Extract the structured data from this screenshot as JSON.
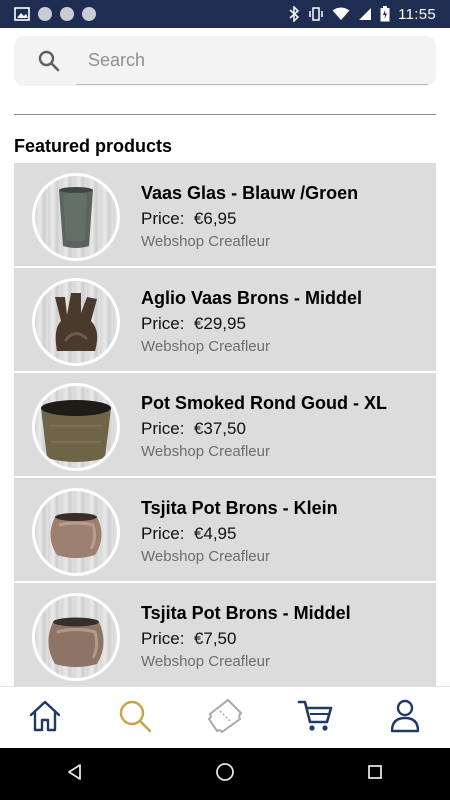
{
  "status_bar": {
    "time": "11:55"
  },
  "search": {
    "placeholder": "Search",
    "value": ""
  },
  "featured": {
    "title": "Featured products",
    "products": [
      {
        "title": "Vaas Glas - Blauw /Groen",
        "price_label": "Price:",
        "price": "€6,95",
        "shop": "Webshop Creafleur",
        "image": "green-glass-vase"
      },
      {
        "title": "Aglio Vaas Brons - Middel",
        "price_label": "Price:",
        "price": "€29,95",
        "shop": "Webshop Creafleur",
        "image": "bronze-garlic-vase"
      },
      {
        "title": "Pot Smoked Rond Goud - XL",
        "price_label": "Price:",
        "price": "€37,50",
        "shop": "Webshop Creafleur",
        "image": "gold-smoked-pot"
      },
      {
        "title": "Tsjita Pot Brons - Klein",
        "price_label": "Price:",
        "price": "€4,95",
        "shop": "Webshop Creafleur",
        "image": "bronze-round-pot"
      },
      {
        "title": "Tsjita Pot Brons - Middel",
        "price_label": "Price:",
        "price": "€7,50",
        "shop": "Webshop Creafleur",
        "image": "bronze-round-pot"
      }
    ]
  },
  "bottom_nav": {
    "items": [
      "home-icon",
      "search-icon",
      "ticket-icon",
      "cart-icon",
      "user-icon"
    ],
    "active": "search-icon"
  },
  "colors": {
    "status_bar": "#1f2d52",
    "nav_icon": "#1f3a66",
    "nav_active": "#c9a24a",
    "card_bg": "#dcdcdc"
  }
}
